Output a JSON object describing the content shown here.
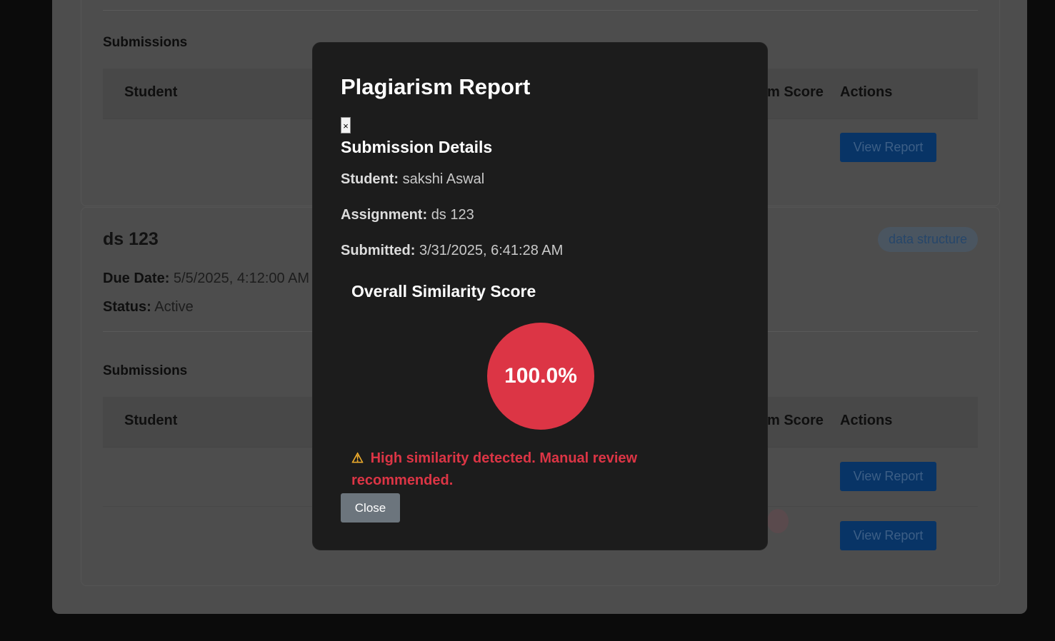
{
  "background": {
    "card1": {
      "submissions_label": "Submissions",
      "col_student": "Student",
      "col_score": "m Score",
      "col_actions": "Actions",
      "view_report": "View Report"
    },
    "card2": {
      "assignment_title": "ds 123",
      "due_label": "Due Date:",
      "due_value": "5/5/2025, 4:12:00 AM",
      "status_label": "Status:",
      "status_value": "Active",
      "tag": "data structure",
      "submissions_label": "Submissions",
      "col_student": "Student",
      "col_score": "m Score",
      "col_actions": "Actions",
      "view_report_1": "View Report",
      "view_report_2": "View Report"
    }
  },
  "modal": {
    "title": "Plagiarism Report",
    "close_x": "×",
    "details_heading": "Submission Details",
    "student_label": "Student:",
    "student_value": "sakshi Aswal",
    "assignment_label": "Assignment:",
    "assignment_value": "ds 123",
    "submitted_label": "Submitted:",
    "submitted_value": "3/31/2025, 6:41:28 AM",
    "score_heading": "Overall Similarity Score",
    "score_value": "100.0%",
    "warning_icon": "⚠",
    "warning_text": "High similarity detected. Manual review recommended.",
    "close_button": "Close"
  },
  "colors": {
    "score_circle": "#dc3545",
    "warning_text": "#dc3545",
    "warning_icon": "#f0ad2c",
    "close_button": "#6c757d",
    "modal_bg": "#1c1c1c"
  },
  "icons": {
    "warning": "warning-triangle-icon",
    "close": "close-icon"
  }
}
